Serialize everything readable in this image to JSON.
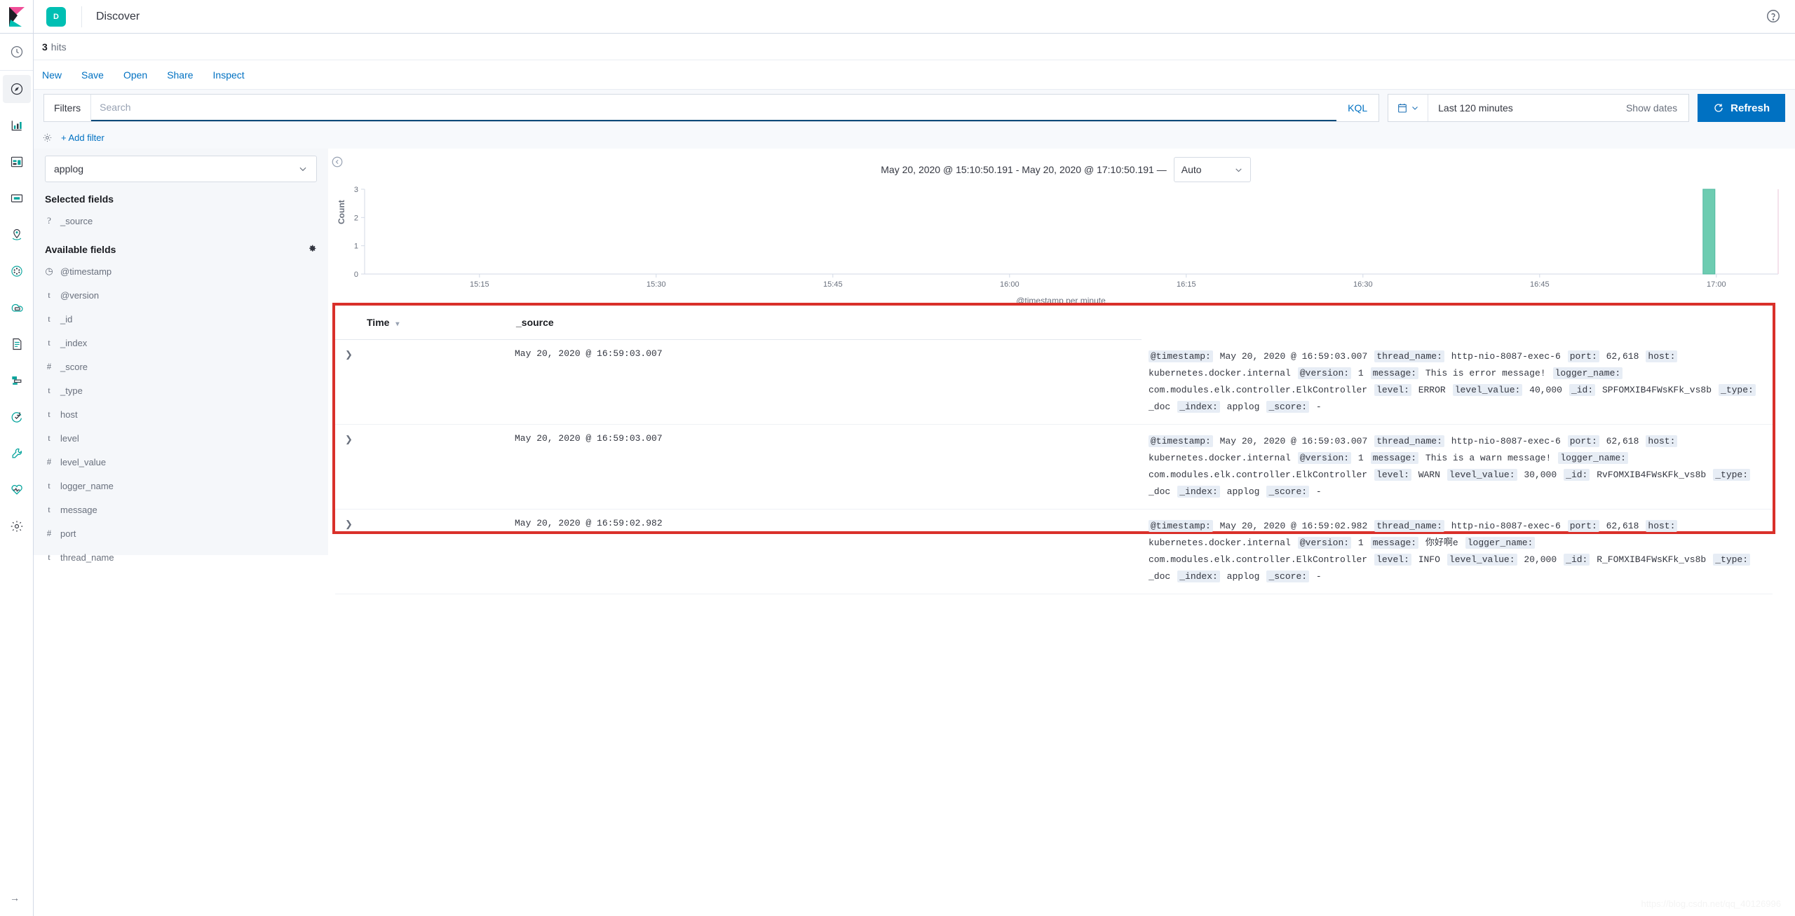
{
  "header": {
    "app_badge": "D",
    "app_title": "Discover",
    "logo_icon": "kibana-logo",
    "help_icon": "help-circle-icon"
  },
  "hits": {
    "count": "3",
    "label": "hits"
  },
  "menu": {
    "items": [
      {
        "name": "new",
        "label": "New"
      },
      {
        "name": "save",
        "label": "Save"
      },
      {
        "name": "open",
        "label": "Open"
      },
      {
        "name": "share",
        "label": "Share"
      },
      {
        "name": "inspect",
        "label": "Inspect"
      }
    ]
  },
  "query_bar": {
    "filters_label": "Filters",
    "search_value": "",
    "search_placeholder": "Search",
    "language_label": "KQL",
    "calendar_icon": "calendar-icon",
    "date_range_label": "Last 120 minutes",
    "show_dates_label": "Show dates",
    "refresh_label": "Refresh",
    "refresh_icon": "refresh-icon",
    "refresh_color": "#0071c2",
    "add_filter_label": "+ Add filter",
    "settings_icon": "gear-icon"
  },
  "sidebar": {
    "index_pattern": "applog",
    "selected_fields_title": "Selected fields",
    "available_fields_title": "Available fields",
    "settings_icon": "gear-icon",
    "selected_fields": [
      {
        "type": "?",
        "name": "_source"
      }
    ],
    "available_fields": [
      {
        "type": "◷",
        "name": "@timestamp"
      },
      {
        "type": "t",
        "name": "@version"
      },
      {
        "type": "t",
        "name": "_id"
      },
      {
        "type": "t",
        "name": "_index"
      },
      {
        "type": "#",
        "name": "_score"
      },
      {
        "type": "t",
        "name": "_type"
      },
      {
        "type": "t",
        "name": "host"
      },
      {
        "type": "t",
        "name": "level"
      },
      {
        "type": "#",
        "name": "level_value"
      },
      {
        "type": "t",
        "name": "logger_name"
      },
      {
        "type": "t",
        "name": "message"
      },
      {
        "type": "#",
        "name": "port"
      },
      {
        "type": "t",
        "name": "thread_name"
      }
    ]
  },
  "chart_header": {
    "range_text": "May 20, 2020 @ 15:10:50.191 - May 20, 2020 @ 17:10:50.191 —",
    "interval_value": "Auto",
    "collapse_icon": "chevron-left-circle-icon"
  },
  "chart_data": {
    "type": "bar",
    "title": "",
    "xlabel": "@timestamp per minute",
    "ylabel": "Count",
    "ylim": [
      0,
      3
    ],
    "yticks": [
      "0",
      "1",
      "2",
      "3"
    ],
    "xticks": [
      "15:15",
      "15:30",
      "15:45",
      "16:00",
      "16:15",
      "16:30",
      "16:45",
      "17:00"
    ],
    "bar_color": "#6DCCB1",
    "grid": false,
    "legend": "none",
    "categories": [
      "16:59"
    ],
    "values": [
      3
    ]
  },
  "documents": {
    "columns": [
      {
        "name": "time",
        "label": "Time",
        "sortable": true
      },
      {
        "name": "source",
        "label": "_source",
        "sortable": false
      }
    ],
    "highlight_color": "#d9302a",
    "rows": [
      {
        "time": "May 20, 2020 @ 16:59:03.007",
        "fields": [
          {
            "key": "@timestamp:",
            "value": "May 20, 2020 @ 16:59:03.007"
          },
          {
            "key": "thread_name:",
            "value": "http-nio-8087-exec-6"
          },
          {
            "key": "port:",
            "value": "62,618"
          },
          {
            "key": "host:",
            "value": "kubernetes.docker.internal"
          },
          {
            "key": "@version:",
            "value": "1"
          },
          {
            "key": "message:",
            "value": "This is error message!"
          },
          {
            "key": "logger_name:",
            "value": "com.modules.elk.controller.ElkController"
          },
          {
            "key": "level:",
            "value": "ERROR"
          },
          {
            "key": "level_value:",
            "value": "40,000"
          },
          {
            "key": "_id:",
            "value": "SPFOMXIB4FWsKFk_vs8b"
          },
          {
            "key": "_type:",
            "value": "_doc"
          },
          {
            "key": "_index:",
            "value": "applog"
          },
          {
            "key": "_score:",
            "value": "-"
          }
        ]
      },
      {
        "time": "May 20, 2020 @ 16:59:03.007",
        "fields": [
          {
            "key": "@timestamp:",
            "value": "May 20, 2020 @ 16:59:03.007"
          },
          {
            "key": "thread_name:",
            "value": "http-nio-8087-exec-6"
          },
          {
            "key": "port:",
            "value": "62,618"
          },
          {
            "key": "host:",
            "value": "kubernetes.docker.internal"
          },
          {
            "key": "@version:",
            "value": "1"
          },
          {
            "key": "message:",
            "value": "This is a warn message!"
          },
          {
            "key": "logger_name:",
            "value": "com.modules.elk.controller.ElkController"
          },
          {
            "key": "level:",
            "value": "WARN"
          },
          {
            "key": "level_value:",
            "value": "30,000"
          },
          {
            "key": "_id:",
            "value": "RvFOMXIB4FWsKFk_vs8b"
          },
          {
            "key": "_type:",
            "value": "_doc"
          },
          {
            "key": "_index:",
            "value": "applog"
          },
          {
            "key": "_score:",
            "value": "-"
          }
        ]
      },
      {
        "time": "May 20, 2020 @ 16:59:02.982",
        "fields": [
          {
            "key": "@timestamp:",
            "value": "May 20, 2020 @ 16:59:02.982"
          },
          {
            "key": "thread_name:",
            "value": "http-nio-8087-exec-6"
          },
          {
            "key": "port:",
            "value": "62,618"
          },
          {
            "key": "host:",
            "value": "kubernetes.docker.internal"
          },
          {
            "key": "@version:",
            "value": "1"
          },
          {
            "key": "message:",
            "value": "你好啊e"
          },
          {
            "key": "logger_name:",
            "value": "com.modules.elk.controller.ElkController"
          },
          {
            "key": "level:",
            "value": "INFO"
          },
          {
            "key": "level_value:",
            "value": "20,000"
          },
          {
            "key": "_id:",
            "value": "R_FOMXIB4FWsKFk_vs8b"
          },
          {
            "key": "_type:",
            "value": "_doc"
          },
          {
            "key": "_index:",
            "value": "applog"
          },
          {
            "key": "_score:",
            "value": "-"
          }
        ]
      }
    ]
  },
  "rail": {
    "items": [
      {
        "name": "recently-viewed",
        "icon": "clock-icon",
        "active": false
      },
      {
        "name": "discover",
        "icon": "compass-icon",
        "active": true
      },
      {
        "name": "visualize",
        "icon": "bar-chart-icon",
        "active": false
      },
      {
        "name": "dashboard",
        "icon": "dashboard-icon",
        "active": false
      },
      {
        "name": "canvas",
        "icon": "canvas-icon",
        "active": false
      },
      {
        "name": "maps",
        "icon": "map-marker-icon",
        "active": false
      },
      {
        "name": "machine-learning",
        "icon": "nodes-icon",
        "active": false
      },
      {
        "name": "infrastructure",
        "icon": "infra-icon",
        "active": false
      },
      {
        "name": "logs",
        "icon": "document-icon",
        "active": false
      },
      {
        "name": "apm",
        "icon": "apm-icon",
        "active": false
      },
      {
        "name": "uptime",
        "icon": "uptime-icon",
        "active": false
      },
      {
        "name": "dev-tools",
        "icon": "wrench-icon",
        "active": false
      },
      {
        "name": "monitoring",
        "icon": "heartbeat-icon",
        "active": false
      },
      {
        "name": "management",
        "icon": "gear-icon",
        "active": false
      }
    ],
    "expand_icon": "arrow-right-icon"
  },
  "watermark": "https://blog.csdn.net/qq_40126996"
}
